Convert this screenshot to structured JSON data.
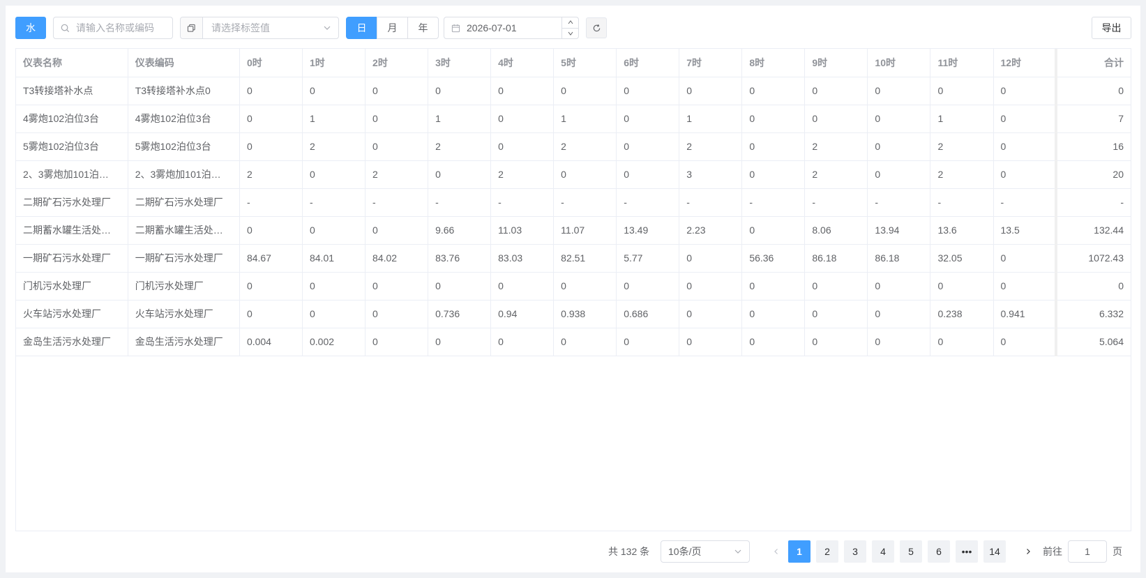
{
  "toolbar": {
    "type_button": "水",
    "search_placeholder": "请输入名称或编码",
    "tag_placeholder": "请选择标签值",
    "period_tabs": [
      {
        "label": "日",
        "active": true
      },
      {
        "label": "月",
        "active": false
      },
      {
        "label": "年",
        "active": false
      }
    ],
    "date_value": "2026-07-01",
    "export_label": "导出"
  },
  "table": {
    "headers": [
      "仪表名称",
      "仪表编码",
      "0时",
      "1时",
      "2时",
      "3时",
      "4时",
      "5时",
      "6时",
      "7时",
      "8时",
      "9时",
      "10时",
      "11时",
      "12时",
      "合计"
    ],
    "rows": [
      [
        "T3转接塔补水点",
        "T3转接塔补水点0",
        "0",
        "0",
        "0",
        "0",
        "0",
        "0",
        "0",
        "0",
        "0",
        "0",
        "0",
        "0",
        "0",
        "0"
      ],
      [
        "4雾炮102泊位3台",
        "4雾炮102泊位3台",
        "0",
        "1",
        "0",
        "1",
        "0",
        "1",
        "0",
        "1",
        "0",
        "0",
        "0",
        "1",
        "0",
        "7"
      ],
      [
        "5雾炮102泊位3台",
        "5雾炮102泊位3台",
        "0",
        "2",
        "0",
        "2",
        "0",
        "2",
        "0",
        "2",
        "0",
        "2",
        "0",
        "2",
        "0",
        "16"
      ],
      [
        "2、3雾炮加101泊…",
        "2、3雾炮加101泊…",
        "2",
        "0",
        "2",
        "0",
        "2",
        "0",
        "0",
        "3",
        "0",
        "2",
        "0",
        "2",
        "0",
        "20"
      ],
      [
        "二期矿石污水处理厂",
        "二期矿石污水处理厂",
        "-",
        "-",
        "-",
        "-",
        "-",
        "-",
        "-",
        "-",
        "-",
        "-",
        "-",
        "-",
        "-",
        "-"
      ],
      [
        "二期蓄水罐生活处…",
        "二期蓄水罐生活处…",
        "0",
        "0",
        "0",
        "9.66",
        "11.03",
        "11.07",
        "13.49",
        "2.23",
        "0",
        "8.06",
        "13.94",
        "13.6",
        "13.5",
        "132.44"
      ],
      [
        "一期矿石污水处理厂",
        "一期矿石污水处理厂",
        "84.67",
        "84.01",
        "84.02",
        "83.76",
        "83.03",
        "82.51",
        "5.77",
        "0",
        "56.36",
        "86.18",
        "86.18",
        "32.05",
        "0",
        "1072.43"
      ],
      [
        "门机污水处理厂",
        "门机污水处理厂",
        "0",
        "0",
        "0",
        "0",
        "0",
        "0",
        "0",
        "0",
        "0",
        "0",
        "0",
        "0",
        "0",
        "0"
      ],
      [
        "火车站污水处理厂",
        "火车站污水处理厂",
        "0",
        "0",
        "0",
        "0.736",
        "0.94",
        "0.938",
        "0.686",
        "0",
        "0",
        "0",
        "0",
        "0.238",
        "0.941",
        "6.332"
      ],
      [
        "金岛生活污水处理厂",
        "金岛生活污水处理厂",
        "0.004",
        "0.002",
        "0",
        "0",
        "0",
        "0",
        "0",
        "0",
        "0",
        "0",
        "0",
        "0",
        "0",
        "5.064"
      ]
    ]
  },
  "pagination": {
    "total_text": "共 132 条",
    "page_size": "10条/页",
    "pages": [
      {
        "label": "1",
        "active": true
      },
      {
        "label": "2",
        "active": false
      },
      {
        "label": "3",
        "active": false
      },
      {
        "label": "4",
        "active": false
      },
      {
        "label": "5",
        "active": false
      },
      {
        "label": "6",
        "active": false
      },
      {
        "label": "•••",
        "active": false
      },
      {
        "label": "14",
        "active": false
      }
    ],
    "goto_prefix": "前往",
    "goto_value": "1",
    "goto_suffix": "页"
  },
  "colors": {
    "primary": "#409eff",
    "border": "#dcdfe6",
    "background": "#f0f2f5"
  }
}
